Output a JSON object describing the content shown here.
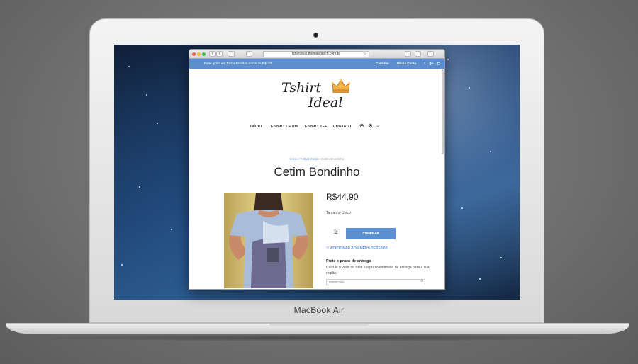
{
  "device": {
    "brand_label": "MacBook Air"
  },
  "browser": {
    "url": "tshirtideal.thomasgroch.com.br",
    "nav_back": "‹",
    "nav_forward": "›"
  },
  "site": {
    "topbar": {
      "promo": "Frete grátis em Todos Pedidos acima de R$100!",
      "cart_link": "Carrinho",
      "account_link": "Minha Conta",
      "social": [
        "f",
        "g+",
        "◻"
      ]
    },
    "logo": {
      "line1": "Tshirt",
      "line2": "Ideal"
    },
    "nav": [
      "INÍCIO",
      "T-SHIRT CETIM",
      "T-SHIRT TEE",
      "CONTATO"
    ],
    "breadcrumb": {
      "home": "Início",
      "sep1": " / ",
      "category": "T-Shirt Cetim",
      "sep2": " / ",
      "current": "Cetim Bondinho"
    },
    "product": {
      "title": "Cetim Bondinho",
      "price": "R$44,90",
      "size": "Tamanho Único",
      "quantity": "1",
      "buy_label": "COMPRAR",
      "wishlist_label": "ADICIONAR AOS MEUS DESEJOS",
      "shipping_title": "Frete e prazo de entrega",
      "shipping_desc": "Calcule o valor do frete e o prazo estimado de entrega para a sua região.",
      "cep_placeholder": "00000-000"
    }
  },
  "colors": {
    "accent": "#5b8fd0",
    "window_bg": "#ffffff"
  }
}
